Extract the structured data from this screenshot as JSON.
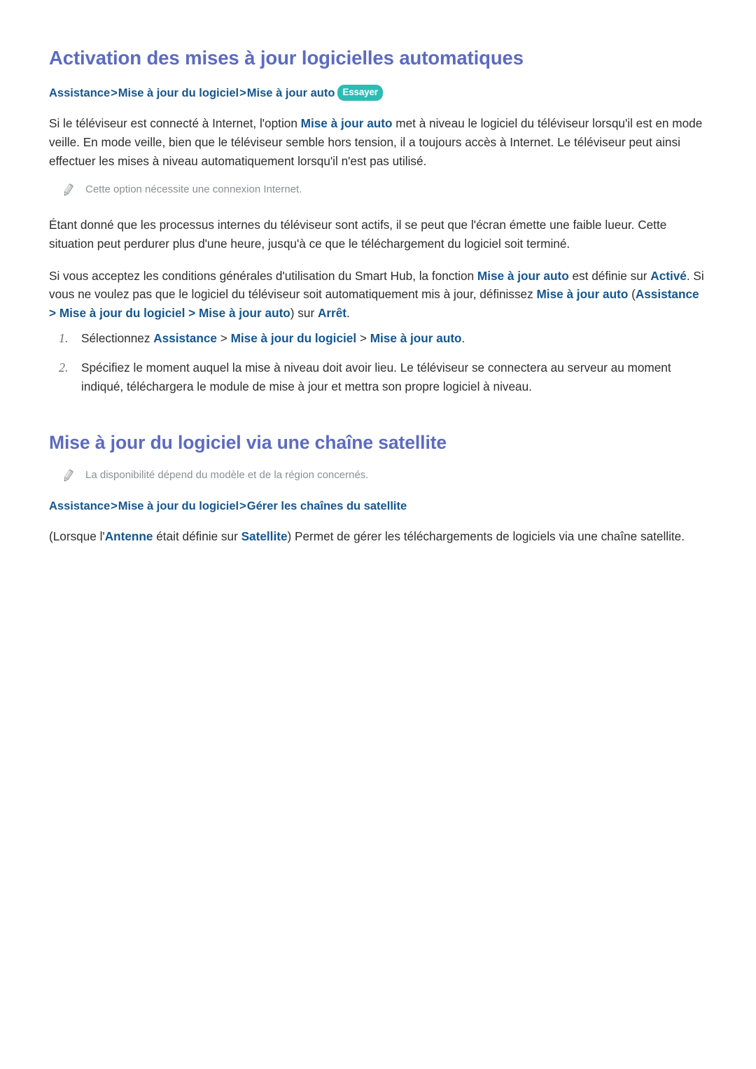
{
  "section1": {
    "heading": "Activation des mises à jour logicielles automatiques",
    "path": {
      "items": [
        "Assistance",
        "Mise à jour du logiciel",
        "Mise à jour auto"
      ],
      "separator": ">",
      "badge": "Essayer"
    },
    "paragraph1": {
      "part1": "Si le téléviseur est connecté à Internet, l'option ",
      "term1": "Mise à jour auto",
      "part2": " met à niveau le logiciel du téléviseur lorsqu'il est en mode veille. En mode veille, bien que le téléviseur semble hors tension, il a toujours accès à Internet. Le téléviseur peut ainsi effectuer les mises à niveau automatiquement lorsqu'il n'est pas utilisé."
    },
    "note1": "Cette option nécessite une connexion Internet.",
    "paragraph2": "Étant donné que les processus internes du téléviseur sont actifs, il se peut que l'écran émette une faible lueur. Cette situation peut perdurer plus d'une heure, jusqu'à ce que le téléchargement du logiciel soit terminé.",
    "paragraph3": {
      "part1": "Si vous acceptez les conditions générales d'utilisation du Smart Hub, la fonction ",
      "term1": "Mise à jour auto",
      "part2": " est définie sur ",
      "term2": "Activé",
      "part3": ". Si vous ne voulez pas que le logiciel du téléviseur soit automatiquement mis à jour, définissez ",
      "term3": "Mise à jour auto",
      "part4": " (",
      "term4": "Assistance",
      "sep1": " > ",
      "term5": "Mise à jour du logiciel",
      "sep2": " > ",
      "term6": "Mise à jour auto",
      "part5": ") sur ",
      "term7": "Arrêt",
      "part6": "."
    },
    "steps": [
      {
        "number": "1.",
        "part1": "Sélectionnez ",
        "term1": "Assistance",
        "sep1": " > ",
        "term2": "Mise à jour du logiciel",
        "sep2": " > ",
        "term3": "Mise à jour auto",
        "part2": "."
      },
      {
        "number": "2.",
        "text": "Spécifiez le moment auquel la mise à niveau doit avoir lieu. Le téléviseur se connectera au serveur au moment indiqué, téléchargera le module de mise à jour et mettra son propre logiciel à niveau."
      }
    ]
  },
  "section2": {
    "heading": "Mise à jour du logiciel via une chaîne satellite",
    "note1": "La disponibilité dépend du modèle et de la région concernés.",
    "path": {
      "items": [
        "Assistance",
        "Mise à jour du logiciel",
        "Gérer les chaînes du satellite"
      ],
      "separator": ">"
    },
    "paragraph1": {
      "part1": "(Lorsque l'",
      "term1": "Antenne",
      "part2": " était définie sur ",
      "term2": "Satellite",
      "part3": ") Permet de gérer les téléchargements de logiciels via une chaîne satellite."
    }
  },
  "colors": {
    "heading": "#5c6bc0",
    "link": "#15568f",
    "body": "#2d2d2d",
    "note": "#8b8f92",
    "badge_bg": "#2bbcb4",
    "badge_text": "#ffffff",
    "list_number": "#6f6f6f"
  }
}
